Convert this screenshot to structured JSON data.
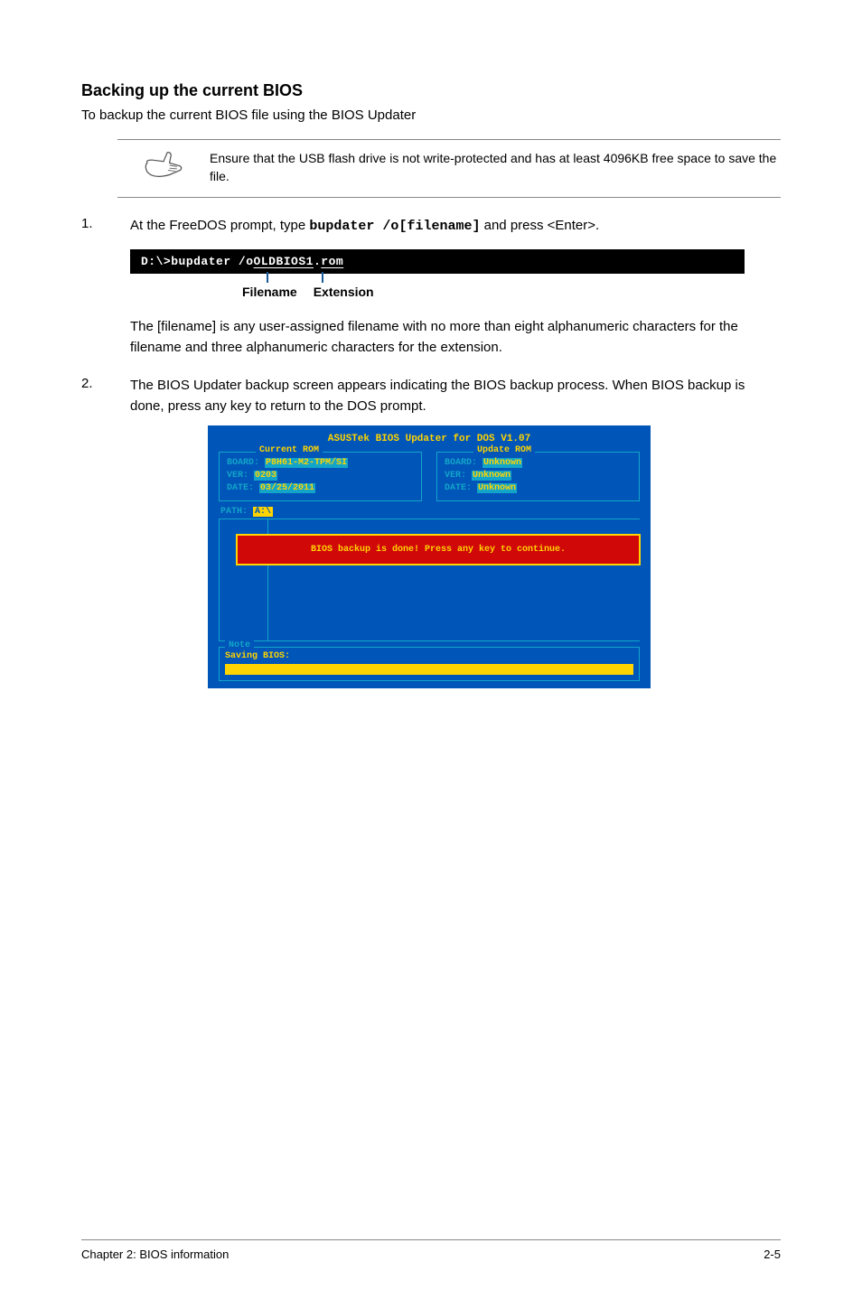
{
  "heading": "Backing up the current BIOS",
  "subheading": "To backup the current BIOS file using the BIOS Updater",
  "note1": "Ensure that the USB flash drive is not write-protected and has at least 4096KB free space to save the file.",
  "step1": {
    "num": "1.",
    "text_before_cmd": "At the FreeDOS prompt, type ",
    "cmd_inline": "bupdater /o[filename]",
    "text_after_cmd": " and press <Enter>."
  },
  "cmdbox": {
    "prompt": "D:\\>",
    "cmd": "bupdater /o",
    "filename_part": "OLDBIOS1",
    "dot": ".",
    "ext_part": "rom"
  },
  "labels": {
    "filename": "Filename",
    "extension": "Extension"
  },
  "filename_explain": "The [filename] is any user-assigned filename with no more than eight alphanumeric characters for the filename and three alphanumeric characters for the extension.",
  "step2": {
    "num": "2.",
    "text": "The BIOS Updater backup screen appears indicating the BIOS backup process. When BIOS backup is done, press any key to return to the DOS prompt."
  },
  "bios": {
    "title": "ASUSTek BIOS Updater for DOS V1.07",
    "current": {
      "legend": "Current ROM",
      "board_lbl": "BOARD:",
      "board_val": "P8H61-M2-TPM/SI",
      "ver_lbl": "VER:",
      "ver_val": "0203",
      "date_lbl": "DATE:",
      "date_val": "03/25/2011"
    },
    "update": {
      "legend": "Update ROM",
      "board_lbl": "BOARD:",
      "board_val": "Unknown",
      "ver_lbl": "VER:",
      "ver_val": "Unknown",
      "date_lbl": "DATE:",
      "date_val": "Unknown"
    },
    "path_lbl": "PATH:",
    "path_val": "A:\\",
    "backup_msg": "BIOS backup is done! Press any key to continue.",
    "note_legend": "Note",
    "saving": "Saving BIOS:"
  },
  "footer": {
    "left": "Chapter 2: BIOS information",
    "right": "2-5"
  }
}
